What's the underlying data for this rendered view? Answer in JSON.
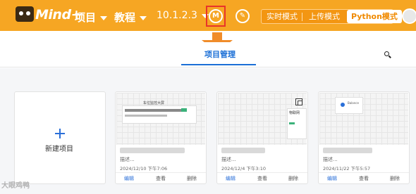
{
  "header": {
    "logo_text": "Mind+",
    "menu_project": "项目",
    "menu_tutorial": "教程",
    "menu_version": "10.1.2.3",
    "manage_icon_label": "M",
    "modes": {
      "realtime": "实时模式",
      "upload": "上传模式",
      "python": "Python模式"
    },
    "accent_color": "#f6a623"
  },
  "tabs": {
    "active": "项目管理"
  },
  "new_project": {
    "label": "新建项目"
  },
  "cards": [
    {
      "thumb_title": "车位监控大屏",
      "desc": "描述...",
      "date": "2024/12/10  下午7:06",
      "edit": "编辑",
      "view": "查看",
      "delete": "删除"
    },
    {
      "thumb_title": "物联网",
      "desc": "描述...",
      "date": "2024/12/4  下午3:10",
      "edit": "编辑",
      "view": "查看",
      "delete": "删除"
    },
    {
      "thumb_title": "Balance",
      "desc": "描述...",
      "date": "2024/11/22  下午5:57",
      "edit": "编辑",
      "view": "查看",
      "delete": "删除"
    }
  ],
  "watermark": "大眼鸡鸭"
}
